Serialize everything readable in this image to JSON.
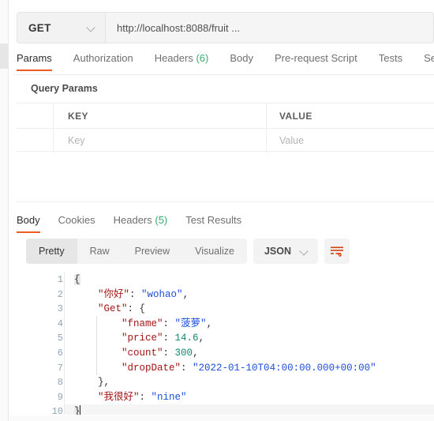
{
  "request": {
    "method": "GET",
    "method_icon": "chevron-down-icon",
    "url": "http://localhost:8088/fruit ...",
    "tabs": [
      {
        "label": "Params",
        "active": true
      },
      {
        "label": "Authorization",
        "active": false
      },
      {
        "label": "Headers",
        "count": "(6)",
        "active": false
      },
      {
        "label": "Body",
        "active": false
      },
      {
        "label": "Pre-request Script",
        "active": false
      },
      {
        "label": "Tests",
        "active": false
      },
      {
        "label": "Setti",
        "active": false
      }
    ],
    "query_params": {
      "title": "Query Params",
      "headers": [
        "",
        "KEY",
        "VALUE"
      ],
      "placeholder_row": [
        "",
        "Key",
        "Value"
      ]
    }
  },
  "response": {
    "tabs": [
      {
        "label": "Body",
        "active": true
      },
      {
        "label": "Cookies",
        "active": false
      },
      {
        "label": "Headers",
        "count": "(5)",
        "active": false
      },
      {
        "label": "Test Results",
        "active": false
      }
    ],
    "view_modes": [
      {
        "label": "Pretty",
        "active": true
      },
      {
        "label": "Raw",
        "active": false
      },
      {
        "label": "Preview",
        "active": false
      },
      {
        "label": "Visualize",
        "active": false
      }
    ],
    "format_select": {
      "value": "JSON",
      "icon": "chevron-down-icon"
    },
    "wrap_button": {
      "icon": "word-wrap-icon"
    },
    "code": {
      "line_numbers": [
        "1",
        "2",
        "3",
        "4",
        "5",
        "6",
        "7",
        "8",
        "9",
        "10"
      ],
      "lines": [
        {
          "indent": "",
          "brace": "{"
        },
        {
          "indent": "    ",
          "key": "\"你好\"",
          "sep": ": ",
          "str": "\"wohao\"",
          "tail": ","
        },
        {
          "indent": "    ",
          "key": "\"Get\"",
          "sep": ": ",
          "brace": "{"
        },
        {
          "indent": "        ",
          "key": "\"fname\"",
          "sep": ": ",
          "str": "\"菠萝\"",
          "tail": ","
        },
        {
          "indent": "        ",
          "key": "\"price\"",
          "sep": ": ",
          "num": "14.6",
          "tail": ","
        },
        {
          "indent": "        ",
          "key": "\"count\"",
          "sep": ": ",
          "num": "300",
          "tail": ","
        },
        {
          "indent": "        ",
          "key": "\"dropDate\"",
          "sep": ": ",
          "str": "\"2022-01-10T04:00:00.000+00:00\""
        },
        {
          "indent": "    ",
          "brace": "}",
          "tail": ","
        },
        {
          "indent": "    ",
          "key": "\"我很好\"",
          "sep": ": ",
          "str": "\"nine\""
        },
        {
          "indent": "",
          "brace": "}",
          "active": true
        }
      ],
      "raw_text": "{\n    \"你好\": \"wohao\",\n    \"Get\": {\n        \"fname\": \"菠萝\",\n        \"price\": 14.6,\n        \"count\": 300,\n        \"dropDate\": \"2022-01-10T04:00:00.000+00:00\"\n    },\n    \"我很好\": \"nine\"\n}"
    }
  },
  "colors": {
    "accent": "#ef5b25",
    "key": "#a31515",
    "string": "#1e4fd8",
    "number": "#0e8a6e",
    "count_badge": "#3aab6e",
    "line_number": "#8fa4b5"
  }
}
